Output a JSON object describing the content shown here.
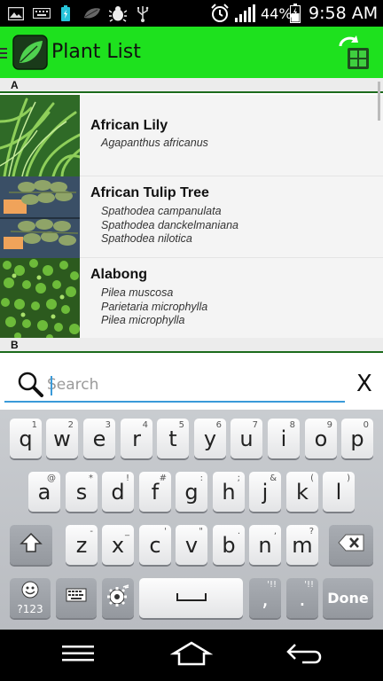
{
  "status_bar": {
    "battery_percent": "44%",
    "time": "9:58 AM",
    "icons": [
      "image-icon",
      "keyboard-icon",
      "battery-charge-icon",
      "leaf-icon",
      "bug-icon",
      "usb-icon",
      "alarm-icon",
      "signal-icon",
      "battery-icon"
    ]
  },
  "app_bar": {
    "title": "Plant List",
    "logo_icon": "leaf-logo-icon",
    "action_icon": "sync-grid-icon"
  },
  "list": {
    "sections": [
      {
        "letter": "A",
        "plants": [
          {
            "name": "African Lily",
            "scientific_names": [
              "Agapanthus africanus"
            ]
          },
          {
            "name": "African Tulip Tree",
            "scientific_names": [
              "Spathodea campanulata",
              "Spathodea danckelmaniana",
              "Spathodea nilotica"
            ]
          },
          {
            "name": "Alabong",
            "scientific_names": [
              "Pilea muscosa",
              "Parietaria microphylla",
              "Pilea microphylla"
            ]
          }
        ]
      },
      {
        "letter": "B",
        "plants": []
      }
    ]
  },
  "search": {
    "placeholder": "Search",
    "value": "",
    "clear_label": "X",
    "search_icon": "search-icon"
  },
  "keyboard": {
    "row1": [
      {
        "key": "q",
        "sub": "1"
      },
      {
        "key": "w",
        "sub": "2"
      },
      {
        "key": "e",
        "sub": "3"
      },
      {
        "key": "r",
        "sub": "4"
      },
      {
        "key": "t",
        "sub": "5"
      },
      {
        "key": "y",
        "sub": "6"
      },
      {
        "key": "u",
        "sub": "7"
      },
      {
        "key": "i",
        "sub": "8"
      },
      {
        "key": "o",
        "sub": "9"
      },
      {
        "key": "p",
        "sub": "0"
      }
    ],
    "row2": [
      {
        "key": "a",
        "sub": "@"
      },
      {
        "key": "s",
        "sub": "*"
      },
      {
        "key": "d",
        "sub": "!"
      },
      {
        "key": "f",
        "sub": "#"
      },
      {
        "key": "g",
        "sub": ":"
      },
      {
        "key": "h",
        "sub": ";"
      },
      {
        "key": "j",
        "sub": "&"
      },
      {
        "key": "k",
        "sub": "("
      },
      {
        "key": "l",
        "sub": ")"
      }
    ],
    "row3": [
      {
        "key": "z",
        "sub": "-"
      },
      {
        "key": "x",
        "sub": "_"
      },
      {
        "key": "c",
        "sub": "'"
      },
      {
        "key": "v",
        "sub": "\""
      },
      {
        "key": "b",
        "sub": "."
      },
      {
        "key": "n",
        "sub": ","
      },
      {
        "key": "m",
        "sub": "?"
      }
    ],
    "shift_icon": "shift-icon",
    "backspace_icon": "backspace-icon",
    "emoji_label": "?123",
    "emoji_icon": "smiley-icon",
    "keyboard_switch_icon": "keyboard-icon",
    "settings_icon": "gear-icon",
    "space_icon": "space-icon",
    "comma_key": {
      "key": ",",
      "sub": "'!!"
    },
    "period_key": {
      "key": ".",
      "sub": "'!!"
    },
    "done_label": "Done"
  },
  "nav_bar": {
    "icons": [
      "menu-icon",
      "home-icon",
      "back-icon"
    ]
  }
}
